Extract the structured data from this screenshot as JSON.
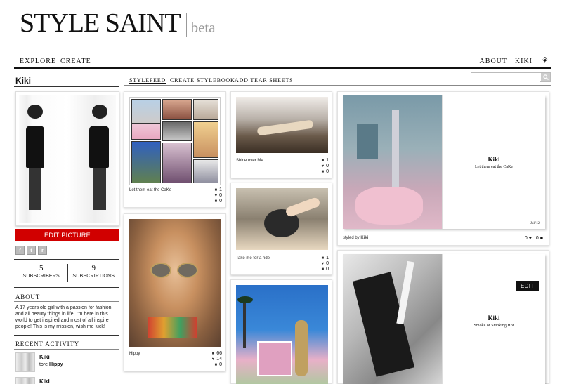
{
  "brand": {
    "name": "StyleSaint",
    "name_display": "STYLE SAINT",
    "tag": "beta"
  },
  "nav": {
    "explore": "EXPLORE",
    "create": "CREATE",
    "about": "ABOUT",
    "user": "KIKI",
    "tree_icon": "⚘"
  },
  "profile": {
    "name": "Kiki",
    "edit_label": "EDIT PICTURE",
    "subscribers": "5",
    "subscribers_label": "SUBSCRIBERS",
    "subscriptions": "9",
    "subscriptions_label": "SUBSCRIPTIONS",
    "about_title": "ABOUT",
    "about_text": "A 17 years old girl with a passion for fashion and all beauty things in life! I'm here in this world to get inspired and most of all inspire people! This is my mission, wish me luck!",
    "recent_title": "RECENT ACTIVITY",
    "activity": [
      {
        "name": "Kiki",
        "verb": "tore",
        "object": "Hippy"
      },
      {
        "name": "Kiki",
        "verb": "",
        "object": ""
      }
    ]
  },
  "social": {
    "facebook": "f",
    "twitter": "t",
    "rss": "r"
  },
  "subnav": {
    "stylefeed": "STYLEFEED",
    "create_stylebook": "CREATE STYLEBOOK",
    "add_tear_sheets": "ADD TEAR SHEETS"
  },
  "search": {
    "placeholder": ""
  },
  "feed": [
    {
      "caption": "Let them eat the CaKe",
      "a": "1",
      "b": "0",
      "c": "0"
    },
    {
      "caption": "Hippy",
      "a": "66",
      "b": "14",
      "c": "0"
    },
    {
      "caption": "Shine over Me",
      "a": "1",
      "b": "0",
      "c": "0"
    },
    {
      "caption": "Take me for a ride",
      "a": "1",
      "b": "0",
      "c": "0"
    }
  ],
  "books": [
    {
      "title": "Kiki",
      "subtitle": "Let them eat the CaKe",
      "date": "Jul '12",
      "styled_by_prefix": "styled by",
      "styled_by": "Kiki",
      "likes": "0",
      "comments": "0"
    },
    {
      "title": "Kiki",
      "subtitle": "Smoke or Smoking Hot",
      "edit": "EDIT"
    }
  ],
  "colors": {
    "accent": "#d10000",
    "nav_rule": "#111111"
  }
}
